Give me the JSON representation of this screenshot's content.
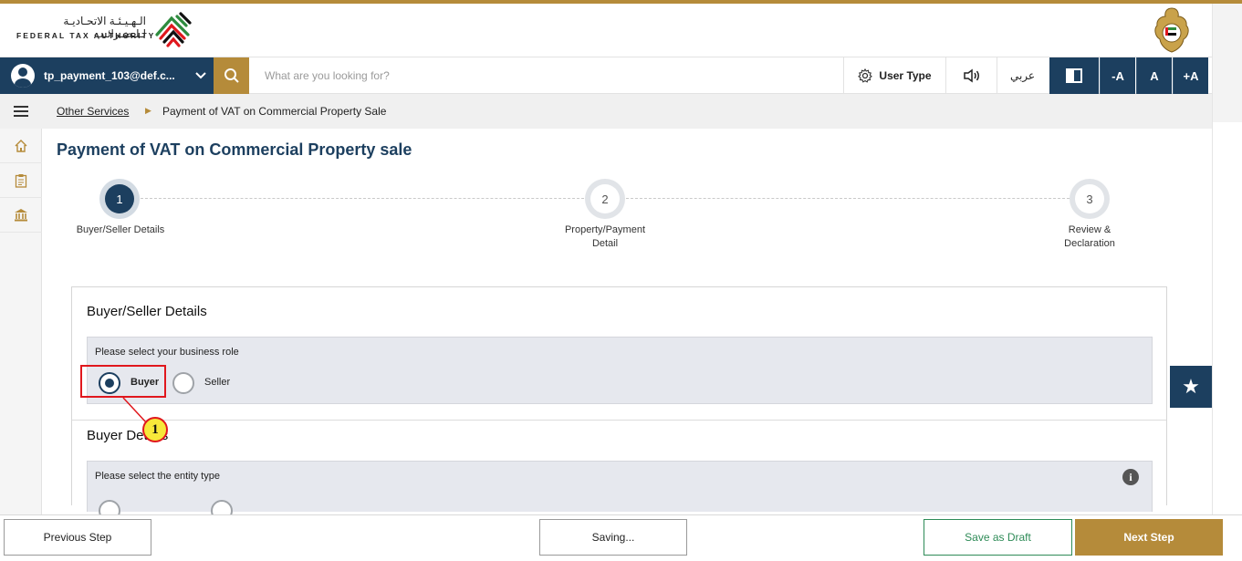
{
  "header": {
    "logo_ar": "الـهـيـئـة الاتحـاديـة لـلـضـرائـب",
    "logo_en": "FEDERAL TAX AUTHORITY"
  },
  "topbar": {
    "user": "tp_payment_103@def.c...",
    "search_placeholder": "What are you looking for?",
    "user_type": "User Type",
    "language": "عربي",
    "font_decrease": "-A",
    "font_normal": "A",
    "font_increase": "+A"
  },
  "breadcrumb": {
    "parent": "Other Services",
    "current": "Payment of VAT on Commercial Property Sale"
  },
  "page": {
    "title": "Payment of VAT on Commercial Property sale"
  },
  "steps": [
    {
      "number": "1",
      "label_line1": "Buyer/Seller Details",
      "label_line2": ""
    },
    {
      "number": "2",
      "label_line1": "Property/Payment",
      "label_line2": "Detail"
    },
    {
      "number": "3",
      "label_line1": "Review &",
      "label_line2": "Declaration"
    }
  ],
  "form": {
    "section1_title": "Buyer/Seller Details",
    "role_label": "Please select your business role",
    "role_options": [
      "Buyer",
      "Seller"
    ],
    "role_selected": "Buyer",
    "section2_title": "Buyer Details",
    "entity_label": "Please select the entity type"
  },
  "annotation": {
    "callout_number": "1"
  },
  "footer": {
    "previous": "Previous Step",
    "saving": "Saving...",
    "save_draft": "Save as Draft",
    "next": "Next Step"
  },
  "colors": {
    "navy": "#1c3f5f",
    "gold": "#b58b3a",
    "draft_green": "#2e8b57",
    "highlight_red": "#e0171d"
  }
}
